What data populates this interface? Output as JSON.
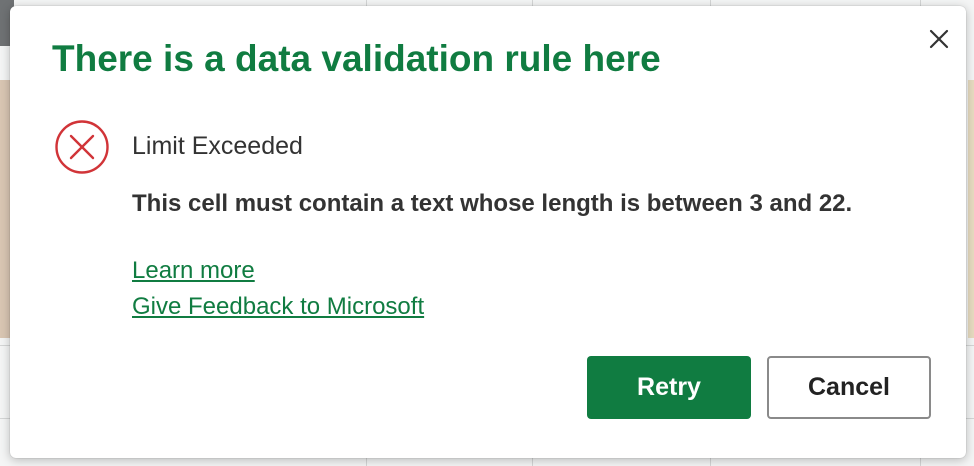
{
  "dialog": {
    "title": "There is a data validation rule here",
    "close_label": "×",
    "error_heading": "Limit Exceeded",
    "message": "This cell must contain a text whose length is between 3 and 22.",
    "links": {
      "learn_more": "Learn more",
      "feedback": "Give Feedback to Microsoft"
    },
    "buttons": {
      "retry": "Retry",
      "cancel": "Cancel"
    }
  },
  "colors": {
    "accent": "#107c41",
    "error_icon": "#d13438"
  },
  "icons": {
    "error": "error-circle-x-icon",
    "close": "close-icon"
  }
}
